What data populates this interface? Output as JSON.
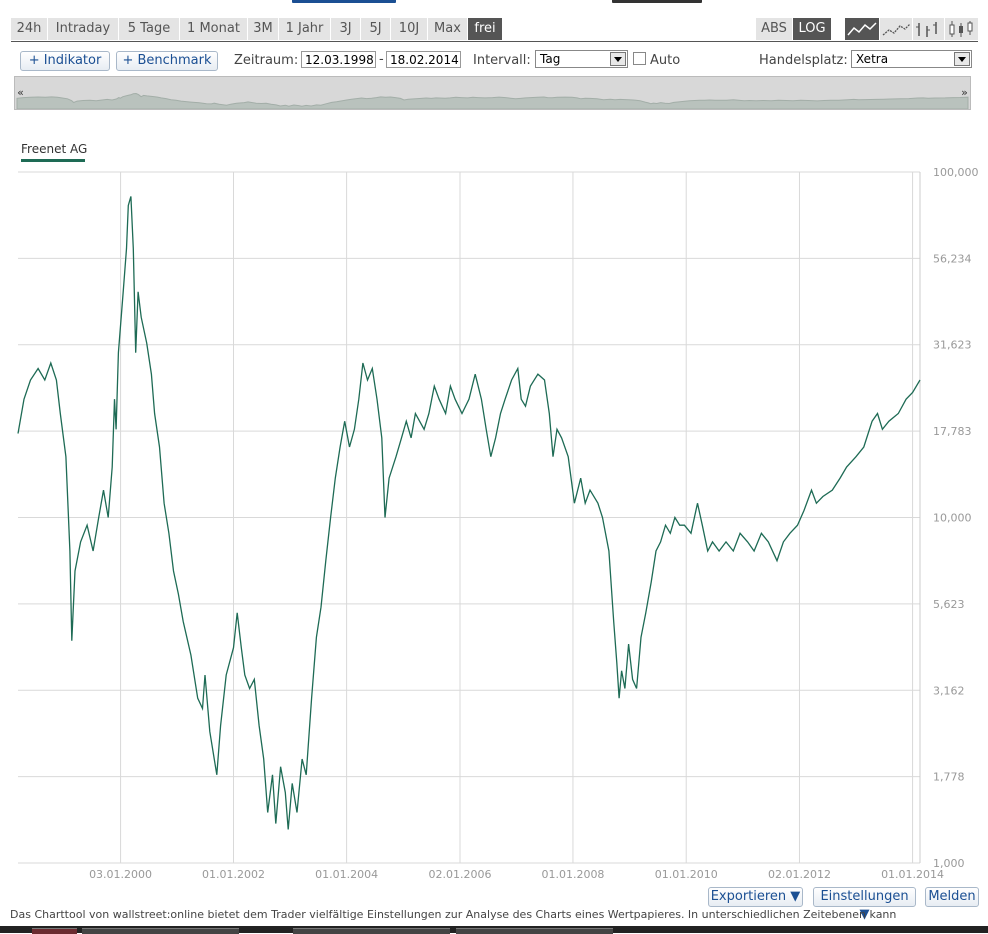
{
  "range_tabs": [
    "24h",
    "Intraday",
    "5 Tage",
    "1 Monat",
    "3M",
    "1 Jahr",
    "3J",
    "5J",
    "10J",
    "Max",
    "frei"
  ],
  "active_range": "frei",
  "scale_tabs": [
    "ABS",
    "LOG"
  ],
  "active_scale": "LOG",
  "chart_styles": [
    "line-chart-icon",
    "mountain-chart-icon",
    "ohlc-chart-icon",
    "candlestick-chart-icon"
  ],
  "toolbar": {
    "indicator_label": "+ Indikator",
    "benchmark_label": "+ Benchmark",
    "period_label": "Zeitraum:",
    "date_from": "12.03.1998",
    "date_sep": "-",
    "date_to": "18.02.2014",
    "interval_label": "Intervall:",
    "interval_value": "Tag",
    "auto_label": "Auto",
    "venue_label": "Handelsplatz:",
    "venue_value": "Xetra"
  },
  "navigator": {
    "left_arrow": "«",
    "right_arrow": "»"
  },
  "legend": {
    "series_name": "Freenet AG"
  },
  "colors": {
    "series": "#1e6b55",
    "grid": "#d9d9d9",
    "active_tab": "#555555"
  },
  "chart_data": {
    "type": "line",
    "yscale": "log",
    "ylim": [
      1,
      100
    ],
    "xlim": [
      "1998-03-12",
      "2014-02-18"
    ],
    "grid": true,
    "y_ticks": [
      "100,000",
      "56,234",
      "31,623",
      "17,783",
      "10,000",
      "5,623",
      "3,162",
      "1,778",
      "1,000"
    ],
    "x_ticks": [
      "03.01.2000",
      "01.01.2002",
      "01.01.2004",
      "02.01.2006",
      "01.01.2008",
      "01.01.2010",
      "02.01.2012",
      "01.01.2014"
    ],
    "series": [
      {
        "name": "Freenet AG",
        "points": [
          [
            "1998-03-12",
            17.5
          ],
          [
            "1998-04-20",
            22
          ],
          [
            "1998-06-01",
            25
          ],
          [
            "1998-07-20",
            27
          ],
          [
            "1998-09-01",
            25
          ],
          [
            "1998-10-10",
            28
          ],
          [
            "1998-11-15",
            25
          ],
          [
            "1998-12-10",
            20
          ],
          [
            "1999-01-15",
            15
          ],
          [
            "1999-02-10",
            8
          ],
          [
            "1999-02-22",
            4.4
          ],
          [
            "1999-03-15",
            7
          ],
          [
            "1999-04-20",
            8.5
          ],
          [
            "1999-06-01",
            9.5
          ],
          [
            "1999-07-10",
            8
          ],
          [
            "1999-08-15",
            10
          ],
          [
            "1999-09-15",
            12
          ],
          [
            "1999-10-15",
            10
          ],
          [
            "1999-11-10",
            14
          ],
          [
            "1999-11-25",
            22
          ],
          [
            "1999-12-05",
            18
          ],
          [
            "1999-12-20",
            30
          ],
          [
            "2000-01-20",
            45
          ],
          [
            "2000-02-10",
            60
          ],
          [
            "2000-02-22",
            80
          ],
          [
            "2000-03-10",
            85
          ],
          [
            "2000-03-25",
            60
          ],
          [
            "2000-04-10",
            30
          ],
          [
            "2000-04-25",
            45
          ],
          [
            "2000-05-15",
            38
          ],
          [
            "2000-06-20",
            32
          ],
          [
            "2000-07-20",
            26
          ],
          [
            "2000-08-10",
            20
          ],
          [
            "2000-09-10",
            16
          ],
          [
            "2000-10-10",
            11
          ],
          [
            "2000-11-10",
            9
          ],
          [
            "2000-12-10",
            7
          ],
          [
            "2001-01-10",
            6
          ],
          [
            "2001-02-10",
            5
          ],
          [
            "2001-04-01",
            4
          ],
          [
            "2001-05-15",
            3
          ],
          [
            "2001-06-15",
            2.8
          ],
          [
            "2001-07-01",
            3.5
          ],
          [
            "2001-08-01",
            2.4
          ],
          [
            "2001-09-15",
            1.8
          ],
          [
            "2001-10-10",
            2.5
          ],
          [
            "2001-11-15",
            3.5
          ],
          [
            "2002-01-01",
            4.2
          ],
          [
            "2002-01-25",
            5.3
          ],
          [
            "2002-02-20",
            4.2
          ],
          [
            "2002-03-15",
            3.5
          ],
          [
            "2002-04-15",
            3.2
          ],
          [
            "2002-05-15",
            3.4
          ],
          [
            "2002-06-15",
            2.5
          ],
          [
            "2002-07-15",
            2.0
          ],
          [
            "2002-08-10",
            1.4
          ],
          [
            "2002-09-10",
            1.8
          ],
          [
            "2002-10-01",
            1.3
          ],
          [
            "2002-11-01",
            1.9
          ],
          [
            "2002-12-01",
            1.6
          ],
          [
            "2002-12-20",
            1.25
          ],
          [
            "2003-01-15",
            1.7
          ],
          [
            "2003-02-15",
            1.4
          ],
          [
            "2003-03-20",
            2.0
          ],
          [
            "2003-04-15",
            1.8
          ],
          [
            "2003-05-20",
            3.0
          ],
          [
            "2003-06-20",
            4.5
          ],
          [
            "2003-07-20",
            5.5
          ],
          [
            "2003-08-20",
            7.5
          ],
          [
            "2003-09-20",
            10
          ],
          [
            "2003-10-20",
            13
          ],
          [
            "2003-11-20",
            16
          ],
          [
            "2003-12-20",
            19
          ],
          [
            "2004-01-20",
            16
          ],
          [
            "2004-02-20",
            18
          ],
          [
            "2004-03-20",
            22
          ],
          [
            "2004-04-15",
            28
          ],
          [
            "2004-05-15",
            25
          ],
          [
            "2004-06-15",
            27
          ],
          [
            "2004-07-15",
            22
          ],
          [
            "2004-08-15",
            17
          ],
          [
            "2004-09-05",
            10
          ],
          [
            "2004-10-01",
            13
          ],
          [
            "2004-11-15",
            15
          ],
          [
            "2004-12-20",
            17
          ],
          [
            "2005-01-20",
            19
          ],
          [
            "2005-02-20",
            17
          ],
          [
            "2005-03-20",
            20
          ],
          [
            "2005-05-15",
            18
          ],
          [
            "2005-06-15",
            20
          ],
          [
            "2005-07-20",
            24
          ],
          [
            "2005-08-20",
            22
          ],
          [
            "2005-10-01",
            20
          ],
          [
            "2005-11-01",
            24
          ],
          [
            "2005-12-01",
            22
          ],
          [
            "2006-01-15",
            20
          ],
          [
            "2006-03-01",
            22
          ],
          [
            "2006-04-10",
            26
          ],
          [
            "2006-05-20",
            22
          ],
          [
            "2006-06-20",
            18
          ],
          [
            "2006-07-20",
            15
          ],
          [
            "2006-08-20",
            17
          ],
          [
            "2006-09-20",
            20
          ],
          [
            "2006-10-20",
            22
          ],
          [
            "2006-12-01",
            25
          ],
          [
            "2007-01-10",
            27
          ],
          [
            "2007-02-01",
            22
          ],
          [
            "2007-03-01",
            21
          ],
          [
            "2007-04-01",
            24
          ],
          [
            "2007-05-20",
            26
          ],
          [
            "2007-07-01",
            25
          ],
          [
            "2007-08-01",
            20
          ],
          [
            "2007-08-25",
            15
          ],
          [
            "2007-09-20",
            18
          ],
          [
            "2007-10-20",
            17
          ],
          [
            "2007-12-01",
            15
          ],
          [
            "2008-01-10",
            11
          ],
          [
            "2008-02-20",
            13
          ],
          [
            "2008-03-20",
            11
          ],
          [
            "2008-04-20",
            12
          ],
          [
            "2008-06-10",
            11
          ],
          [
            "2008-07-10",
            10
          ],
          [
            "2008-08-20",
            8
          ],
          [
            "2008-09-20",
            5
          ],
          [
            "2008-10-10",
            3.8
          ],
          [
            "2008-10-25",
            3.0
          ],
          [
            "2008-11-10",
            3.6
          ],
          [
            "2008-12-01",
            3.2
          ],
          [
            "2008-12-25",
            4.3
          ],
          [
            "2009-01-20",
            3.4
          ],
          [
            "2009-02-15",
            3.2
          ],
          [
            "2009-03-15",
            4.5
          ],
          [
            "2009-04-15",
            5.3
          ],
          [
            "2009-05-20",
            6.5
          ],
          [
            "2009-06-20",
            8
          ],
          [
            "2009-07-20",
            8.5
          ],
          [
            "2009-08-20",
            9.5
          ],
          [
            "2009-09-20",
            9
          ],
          [
            "2009-10-20",
            10
          ],
          [
            "2009-11-20",
            9.5
          ],
          [
            "2009-12-20",
            9.5
          ],
          [
            "2010-02-01",
            9
          ],
          [
            "2010-03-15",
            11
          ],
          [
            "2010-04-15",
            9.5
          ],
          [
            "2010-05-20",
            8
          ],
          [
            "2010-06-20",
            8.5
          ],
          [
            "2010-08-01",
            8
          ],
          [
            "2010-09-15",
            8.5
          ],
          [
            "2010-11-01",
            8
          ],
          [
            "2010-12-15",
            9
          ],
          [
            "2011-02-01",
            8.5
          ],
          [
            "2011-03-15",
            8
          ],
          [
            "2011-05-01",
            9
          ],
          [
            "2011-06-15",
            8.5
          ],
          [
            "2011-08-10",
            7.5
          ],
          [
            "2011-09-20",
            8.5
          ],
          [
            "2011-11-01",
            9
          ],
          [
            "2011-12-20",
            9.5
          ],
          [
            "2012-02-01",
            10.5
          ],
          [
            "2012-03-20",
            12
          ],
          [
            "2012-04-20",
            11
          ],
          [
            "2012-06-01",
            11.5
          ],
          [
            "2012-08-01",
            12
          ],
          [
            "2012-09-20",
            13
          ],
          [
            "2012-11-01",
            14
          ],
          [
            "2013-01-01",
            15
          ],
          [
            "2013-02-20",
            16
          ],
          [
            "2013-04-15",
            19
          ],
          [
            "2013-05-20",
            20
          ],
          [
            "2013-06-20",
            18
          ],
          [
            "2013-08-01",
            19
          ],
          [
            "2013-10-01",
            20
          ],
          [
            "2013-11-20",
            22
          ],
          [
            "2014-01-01",
            23
          ],
          [
            "2014-02-18",
            25
          ]
        ]
      }
    ]
  },
  "footer": {
    "export_label": "Exportieren ▼",
    "settings_label": "Einstellungen ▼",
    "report_label": "Melden",
    "note": "Das Charttool von wallstreet:online bietet dem Trader vielfältige Einstellungen zur Analyse des Charts eines Wertpapieres. In unterschiedlichen Zeitebenen kann"
  }
}
